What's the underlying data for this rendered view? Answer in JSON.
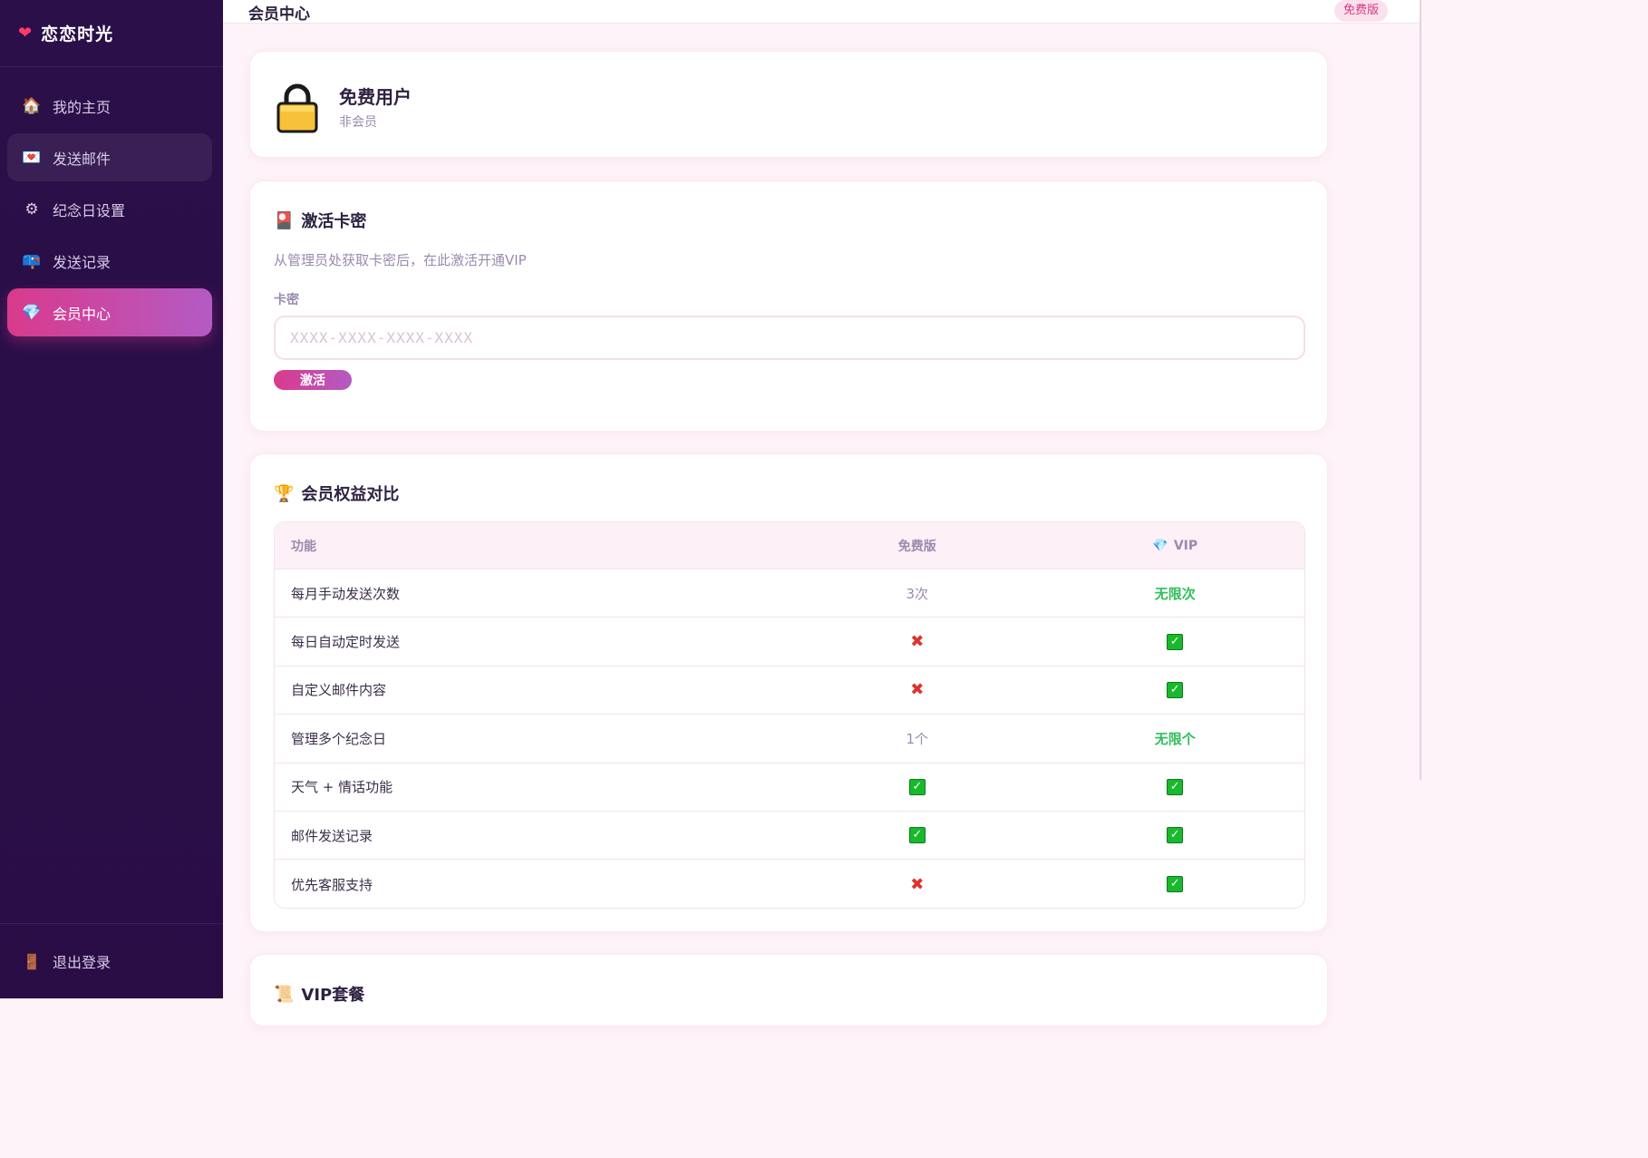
{
  "sidebar": {
    "brand": "恋恋时光",
    "brand_icon": "heart-icon",
    "items": [
      {
        "label": "我的主页",
        "icon": "house-icon"
      },
      {
        "label": "发送邮件",
        "icon": "envelope-icon"
      },
      {
        "label": "纪念日设置",
        "icon": "gear-icon"
      },
      {
        "label": "发送记录",
        "icon": "mailbox-icon"
      },
      {
        "label": "会员中心",
        "icon": "gem-icon"
      }
    ],
    "logout": {
      "label": "退出登录",
      "icon": "door-icon"
    }
  },
  "header": {
    "title": "会员中心",
    "badge": "免费版"
  },
  "status": {
    "title": "免费用户",
    "subtitle": "非会员",
    "icon": "lock-icon"
  },
  "activate": {
    "title": "激活卡密",
    "icon": "card-icon",
    "description": "从管理员处获取卡密后，在此激活开通VIP",
    "field_label": "卡密",
    "placeholder": "XXXX-XXXX-XXXX-XXXX",
    "button": "激活"
  },
  "compare": {
    "title": "会员权益对比",
    "icon": "trophy-icon",
    "headers": {
      "feature": "功能",
      "free": "免费版",
      "vip": "VIP"
    },
    "rows": [
      {
        "feature": "每月手动发送次数",
        "free": "3次",
        "vip": "无限次"
      },
      {
        "feature": "每日自动定时发送",
        "free": "no",
        "vip": "yes"
      },
      {
        "feature": "自定义邮件内容",
        "free": "no",
        "vip": "yes"
      },
      {
        "feature": "管理多个纪念日",
        "free": "1个",
        "vip": "无限个"
      },
      {
        "feature": "天气 + 情话功能",
        "free": "yes",
        "vip": "yes"
      },
      {
        "feature": "邮件发送记录",
        "free": "yes",
        "vip": "yes"
      },
      {
        "feature": "优先客服支持",
        "free": "no",
        "vip": "yes"
      }
    ]
  },
  "plans": {
    "title": "VIP套餐",
    "icon": "scroll-icon"
  },
  "colors": {
    "sidebar_bg": "#2a0e47",
    "accent_start": "#d93a8c",
    "accent_end": "#b45bc4",
    "page_bg": "#fdf3f8",
    "positive": "#2fbf5a"
  }
}
